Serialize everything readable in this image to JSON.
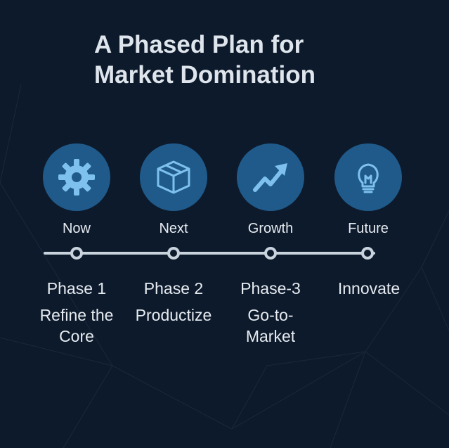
{
  "title": {
    "line1": "A Phased Plan for",
    "line2": "Market Domination"
  },
  "colors": {
    "background": "#0d1a2b",
    "circle": "#1f5a8a",
    "icon": "#7ec1ee",
    "timeline": "#c9d3de"
  },
  "phases": [
    {
      "stage": "Now",
      "icon": "gear-icon",
      "name": "Phase 1",
      "desc": "Refine the Core"
    },
    {
      "stage": "Next",
      "icon": "box-icon",
      "name": "Phase 2",
      "desc": "Productize"
    },
    {
      "stage": "Growth",
      "icon": "trend-arrow-icon",
      "name": "Phase-3",
      "desc": "Go-to-Market"
    },
    {
      "stage": "Future",
      "icon": "lightbulb-icon",
      "name": "Innovate",
      "desc": ""
    }
  ]
}
